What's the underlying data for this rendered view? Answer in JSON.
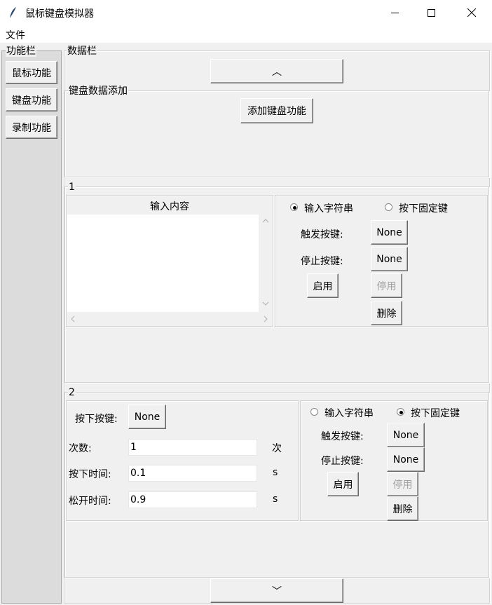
{
  "window": {
    "title": "鼠标键盘模拟器"
  },
  "menu": {
    "file": "文件"
  },
  "sidebar": {
    "title": "功能栏",
    "buttons": [
      "鼠标功能",
      "键盘功能",
      "录制功能"
    ]
  },
  "data_panel": {
    "title": "数据栏",
    "scroll_up": "︿",
    "scroll_down": "﹀",
    "keyboard_add": {
      "title": "键盘数据添加",
      "add_button": "添加键盘功能"
    }
  },
  "entries": [
    {
      "index": "1",
      "input_label": "输入内容",
      "radio_string": "输入字符串",
      "radio_fixed": "按下固定键",
      "selected": "string",
      "trigger_label": "触发按键:",
      "trigger_value": "None",
      "stop_label": "停止按键:",
      "stop_value": "None",
      "enable": "启用",
      "disable": "停用",
      "delete": "删除"
    },
    {
      "index": "2",
      "press_key_label": "按下按键:",
      "press_key_value": "None",
      "count_label": "次数:",
      "count_value": "1",
      "count_unit": "次",
      "press_time_label": "按下时间:",
      "press_time_value": "0.1",
      "press_time_unit": "s",
      "release_time_label": "松开时间:",
      "release_time_value": "0.9",
      "release_time_unit": "s",
      "radio_string": "输入字符串",
      "radio_fixed": "按下固定键",
      "selected": "fixed",
      "trigger_label": "触发按键:",
      "trigger_value": "None",
      "stop_label": "停止按键:",
      "stop_value": "None",
      "enable": "启用",
      "disable": "停用",
      "delete": "删除"
    }
  ]
}
